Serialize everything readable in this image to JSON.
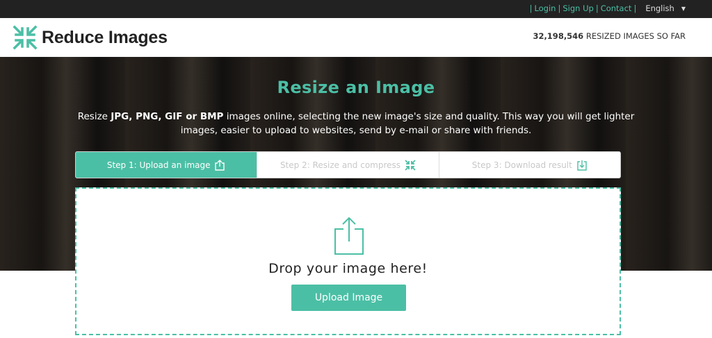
{
  "topbar": {
    "links": [
      {
        "label": "Login"
      },
      {
        "label": "Sign Up"
      },
      {
        "label": "Contact"
      }
    ],
    "language": "English"
  },
  "header": {
    "brand": "Reduce Images",
    "counter_value": "32,198,546",
    "counter_suffix": "RESIZED IMAGES SO FAR"
  },
  "hero": {
    "title": "Resize an Image",
    "desc_prefix": "Resize ",
    "desc_formats": "JPG, PNG, GIF or BMP",
    "desc_suffix": " images online, selecting the new image's size and quality. This way you will get lighter images, easier to upload to websites, send by e-mail or share with friends."
  },
  "steps": [
    {
      "label": "Step 1: Upload an image",
      "icon": "upload-icon",
      "active": true
    },
    {
      "label": "Step 2: Resize and compress",
      "icon": "compress-icon",
      "active": false
    },
    {
      "label": "Step 3: Download result",
      "icon": "download-icon",
      "active": false
    }
  ],
  "dropzone": {
    "text": "Drop your image here!",
    "button_label": "Upload Image"
  },
  "colors": {
    "accent": "#4bbfa5",
    "topbar_bg": "#222222"
  }
}
